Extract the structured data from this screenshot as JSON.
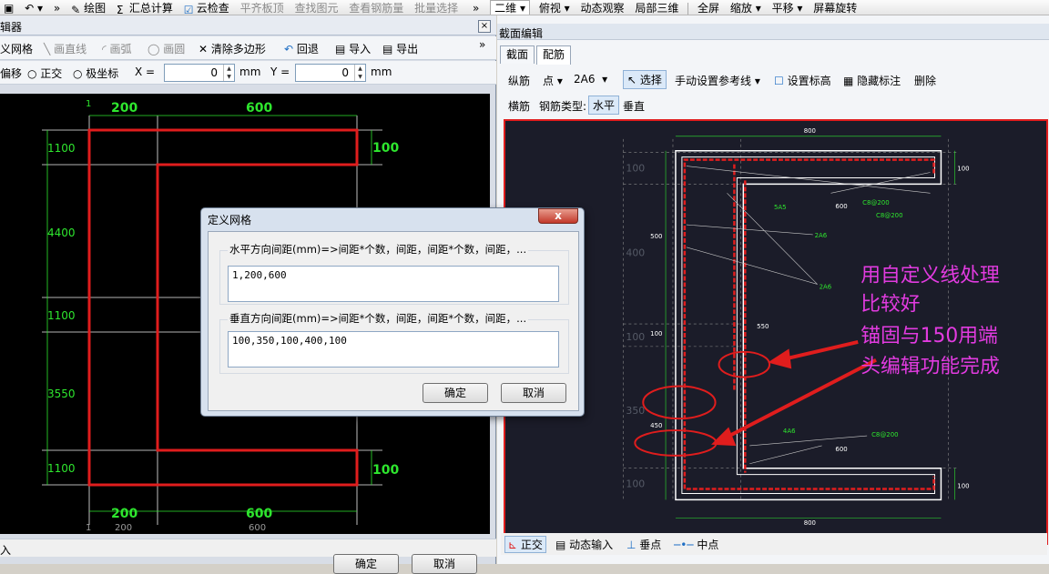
{
  "toolbar": {
    "items": [
      "绘图",
      "汇总计算",
      "云检查",
      "平齐板顶",
      "查找图元",
      "查看钢筋量",
      "批量选择",
      "二维",
      "俯视",
      "动态观察",
      "局部三维",
      "全屏",
      "缩放",
      "平移",
      "屏幕旋转"
    ],
    "more": "»"
  },
  "left_window": {
    "title": "辑器",
    "close": "×",
    "tools1": [
      "义网格",
      "画直线",
      "画弧",
      "画圆",
      "清除多边形",
      "回退",
      "导入",
      "导出"
    ],
    "more": "»",
    "tools2": {
      "offset": "偏移",
      "ortho": "正交",
      "polar": "极坐标",
      "x_label": "X =",
      "x_value": "0",
      "x_unit": "mm",
      "y_label": "Y =",
      "y_value": "0",
      "y_unit": "mm"
    },
    "status": "入",
    "ok": "确定",
    "cancel": "取消"
  },
  "left_canvas": {
    "top_dims": [
      "200",
      "600"
    ],
    "bottom_dims": [
      "200",
      "600"
    ],
    "bottom_dims_small": [
      "200",
      "600"
    ],
    "left_dims": [
      "1100",
      "4400",
      "1100",
      "3550",
      "1100"
    ],
    "right_dims": [
      "100",
      "100"
    ],
    "tick_label": "1"
  },
  "dialog": {
    "title": "定义网格",
    "close": "x",
    "h_label": "水平方向间距(mm)=>间距*个数，间距，间距*个数，间距，...",
    "h_value": "1,200,600",
    "v_label": "垂直方向间距(mm)=>间距*个数，间距，间距*个数，间距，...",
    "v_value": "100,350,100,400,100",
    "ok": "确定",
    "cancel": "取消"
  },
  "right_window": {
    "title": "截面编辑",
    "tabs": [
      "截面",
      "配筋"
    ],
    "row1": {
      "longitudinal": "纵筋",
      "point": "点",
      "bar_spec": "2A6",
      "select": "选择",
      "manual_ref": "手动设置参考线",
      "set_elev": "设置标高",
      "hide_dim": "隐藏标注",
      "delete": "删除"
    },
    "row2": {
      "transverse": "横筋",
      "bar_type_label": "钢筋类型:",
      "horizontal": "水平",
      "vertical": "垂直"
    },
    "status": {
      "ortho": "正交",
      "dyn_input": "动态输入",
      "perp": "垂点",
      "mid": "中点"
    }
  },
  "right_canvas": {
    "dims_top": "800",
    "dims_bottom": "800",
    "dims_left": [
      "100",
      "400",
      "100",
      "350",
      "100"
    ],
    "dim_right_top": "100",
    "dim_right_bottom": "100",
    "labels": [
      "5A5",
      "600",
      "C8@200",
      "C8@200",
      "2A6",
      "2A6",
      "550",
      "100",
      "450",
      "4A6",
      "600",
      "C8@200",
      "500"
    ],
    "annotation": [
      "用自定义线处理",
      "比较好",
      "锚固与150用端",
      "头编辑功能完成"
    ]
  },
  "colors": {
    "annotation": "#e23be0",
    "outline": "#e01d1d",
    "dim": "#2ee62e",
    "canvas": "#000000",
    "rcanvas": "#1b1c29"
  }
}
